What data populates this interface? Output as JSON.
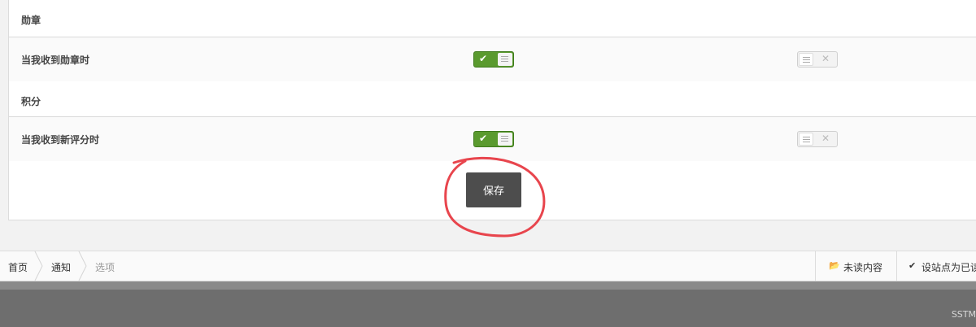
{
  "sections": [
    {
      "header": "勋章",
      "setting_label": "当我收到勋章时",
      "col1_state": "on",
      "col2_state": "off"
    },
    {
      "header": "积分",
      "setting_label": "当我收到新评分时",
      "col1_state": "on",
      "col2_state": "off"
    }
  ],
  "save_button": "保存",
  "breadcrumb": [
    "首页",
    "通知",
    "选项"
  ],
  "bar_actions": [
    {
      "icon": "folder-open-icon",
      "label": "未读内容"
    },
    {
      "icon": "check-icon",
      "label": "设站点为已读"
    }
  ],
  "footer_watermark": "SSTM",
  "colors": {
    "toggle_on": "#5a9a2e",
    "save_button": "#4d4d4d",
    "annotation": "#e8454d"
  }
}
